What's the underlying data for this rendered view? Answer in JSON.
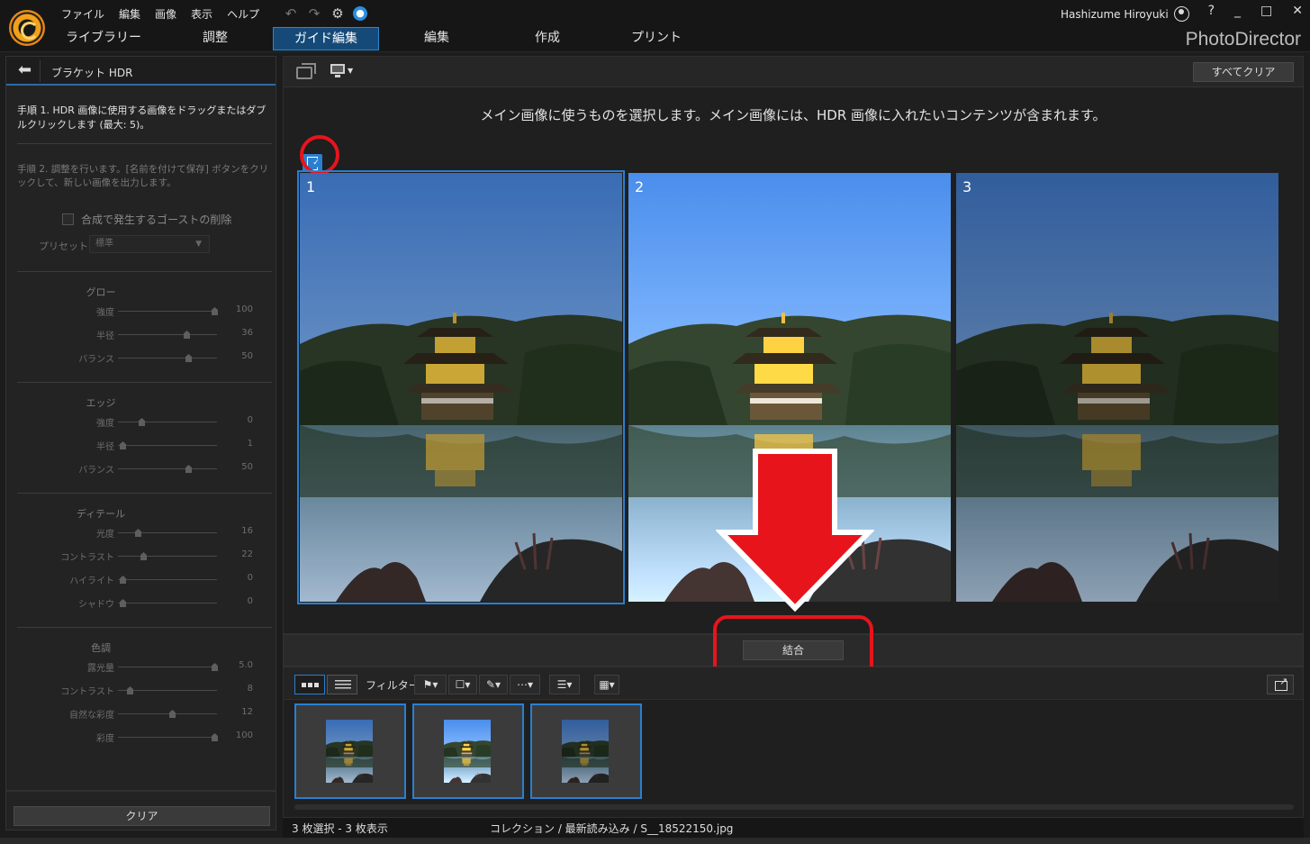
{
  "menu": [
    "ファイル",
    "編集",
    "画像",
    "表示",
    "ヘルプ"
  ],
  "tabs": [
    "ライブラリー",
    "調整",
    "ガイド編集",
    "編集",
    "作成",
    "プリント"
  ],
  "active_tab": "ガイド編集",
  "user": "Hashizume Hiroyuki",
  "window_buttons": [
    "?",
    "_",
    "□",
    "✕"
  ],
  "brand": "PhotoDirector",
  "left_panel": {
    "title": "ブラケット HDR",
    "step1": "手順 1. HDR 画像に使用する画像をドラッグまたはダブルクリックします (最大: 5)。",
    "step2": "手順 2. 調整を行います。[名前を付けて保存] ボタンをクリックして、新しい画像を出力します。",
    "ghost_label": "合成で発生するゴーストの削除",
    "preset_label": "プリセット",
    "preset_value": "標準",
    "groups": [
      {
        "title": "グロー",
        "sliders": [
          {
            "label": "強度",
            "value": "100",
            "pos": 1.0
          },
          {
            "label": "半径",
            "value": "36",
            "pos": 0.7
          },
          {
            "label": "バランス",
            "value": "50",
            "pos": 0.72
          }
        ]
      },
      {
        "title": "エッジ",
        "sliders": [
          {
            "label": "強度",
            "value": "0",
            "pos": 0.22
          },
          {
            "label": "半径",
            "value": "1",
            "pos": 0.02
          },
          {
            "label": "バランス",
            "value": "50",
            "pos": 0.72
          }
        ]
      },
      {
        "title": "ディテール",
        "sliders": [
          {
            "label": "光度",
            "value": "16",
            "pos": 0.18
          },
          {
            "label": "コントラスト",
            "value": "22",
            "pos": 0.24
          },
          {
            "label": "ハイライト",
            "value": "0",
            "pos": 0.02
          },
          {
            "label": "シャドウ",
            "value": "0",
            "pos": 0.02
          }
        ]
      },
      {
        "title": "色調",
        "sliders": [
          {
            "label": "露光量",
            "value": "5.0",
            "pos": 1.0
          },
          {
            "label": "コントラスト",
            "value": "8",
            "pos": 0.1
          },
          {
            "label": "自然な彩度",
            "value": "12",
            "pos": 0.55
          },
          {
            "label": "彩度",
            "value": "100",
            "pos": 1.0
          }
        ]
      }
    ],
    "clear_label": "クリア"
  },
  "main": {
    "clear_all": "すべてクリア",
    "instruction": "メイン画像に使うものを選択します。メイン画像には、HDR 画像に入れたいコンテンツが含まれます。",
    "photos": [
      {
        "num": "1",
        "brightness": 0.9,
        "selected": true
      },
      {
        "num": "2",
        "brightness": 1.18,
        "selected": false
      },
      {
        "num": "3",
        "brightness": 0.78,
        "selected": false
      }
    ],
    "combine_label": "結合"
  },
  "film": {
    "filter_label": "フィルター:",
    "thumbs": 3
  },
  "status": {
    "selection": "3 枚選択 - 3 枚表示",
    "path": "コレクション / 最新読み込み / S__18522150.jpg"
  },
  "colors": {
    "accent": "#2a7fd0",
    "annotation_red": "#e8141c"
  }
}
